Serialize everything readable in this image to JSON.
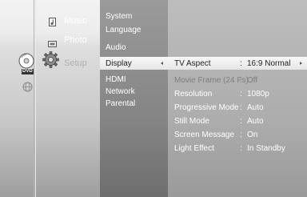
{
  "main_menu": {
    "items": [
      {
        "label": "Music",
        "icon": "music-icon"
      },
      {
        "label": "Photo",
        "icon": "photo-icon"
      },
      {
        "label": "Setup",
        "icon": "gear-icon",
        "selected": true
      }
    ]
  },
  "left_icons": [
    "dvd-disc-icon",
    "globe-icon"
  ],
  "dvd_label": "DVD",
  "setup_menu": {
    "items": [
      "System",
      "Language",
      "Audio",
      "Display",
      "HDMI",
      "Network",
      "Parental"
    ],
    "selected": "Display"
  },
  "display_settings": [
    {
      "label": "TV Aspect",
      "sep": ":",
      "value": "16:9 Normal",
      "active": true
    },
    {
      "label": "Movie Frame (24 Fs)",
      "sep": ":",
      "value": "Off",
      "disabled": true
    },
    {
      "label": "Resolution",
      "sep": ":",
      "value": "1080p"
    },
    {
      "label": "Progressive Mode",
      "sep": ":",
      "value": "Auto"
    },
    {
      "label": "Still Mode",
      "sep": ":",
      "value": "Auto"
    },
    {
      "label": "Screen Message",
      "sep": ":",
      "value": "On"
    },
    {
      "label": "Light Effect",
      "sep": ":",
      "value": "In Standby"
    }
  ],
  "colors": {
    "highlight": "#efefef",
    "text_light": "#ffffff",
    "text_dark": "#1e1e1e",
    "text_disabled": "#7e7e7e"
  }
}
